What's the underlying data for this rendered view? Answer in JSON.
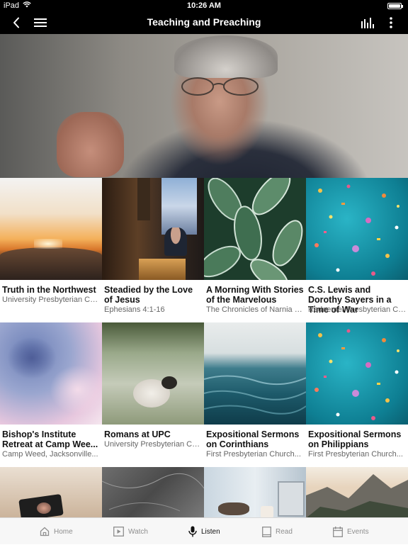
{
  "statusbar": {
    "device": "iPad",
    "time": "10:26 AM"
  },
  "header": {
    "title": "Teaching and Preaching"
  },
  "rows": [
    [
      {
        "title": "Truth in the Northwest",
        "subtitle": "University Presbyterian Ch..."
      },
      {
        "title": "Steadied by the Love of Jesus",
        "subtitle": "Ephesians 4:1-16"
      },
      {
        "title": "A Morning With Stories of the Marvelous",
        "subtitle": "The Chronicles of Narnia a..."
      },
      {
        "title": "C.S. Lewis and Dorothy Sayers in a Time of War",
        "subtitle": "Redeemer Presbyterian Ch..."
      }
    ],
    [
      {
        "title": "Bishop's Institute Retreat at Camp Wee...",
        "subtitle": "Camp Weed, Jacksonville..."
      },
      {
        "title": "Romans at UPC",
        "subtitle": "University Presbyterian Ch..."
      },
      {
        "title": "Expositional Sermons on Corinthians",
        "subtitle": "First Presbyterian Church..."
      },
      {
        "title": "Expositional Sermons on Philippians",
        "subtitle": "First Presbyterian Church..."
      }
    ]
  ],
  "tabs": [
    {
      "label": "Home",
      "icon": "home-icon",
      "active": false
    },
    {
      "label": "Watch",
      "icon": "play-icon",
      "active": false
    },
    {
      "label": "Listen",
      "icon": "microphone-icon",
      "active": true
    },
    {
      "label": "Read",
      "icon": "book-icon",
      "active": false
    },
    {
      "label": "Events",
      "icon": "calendar-icon",
      "active": false
    }
  ],
  "colors": {
    "bar": "#000000",
    "tab_bg": "#f7f7f7",
    "tab_inactive": "#8e8e8e",
    "tab_active": "#111111"
  }
}
